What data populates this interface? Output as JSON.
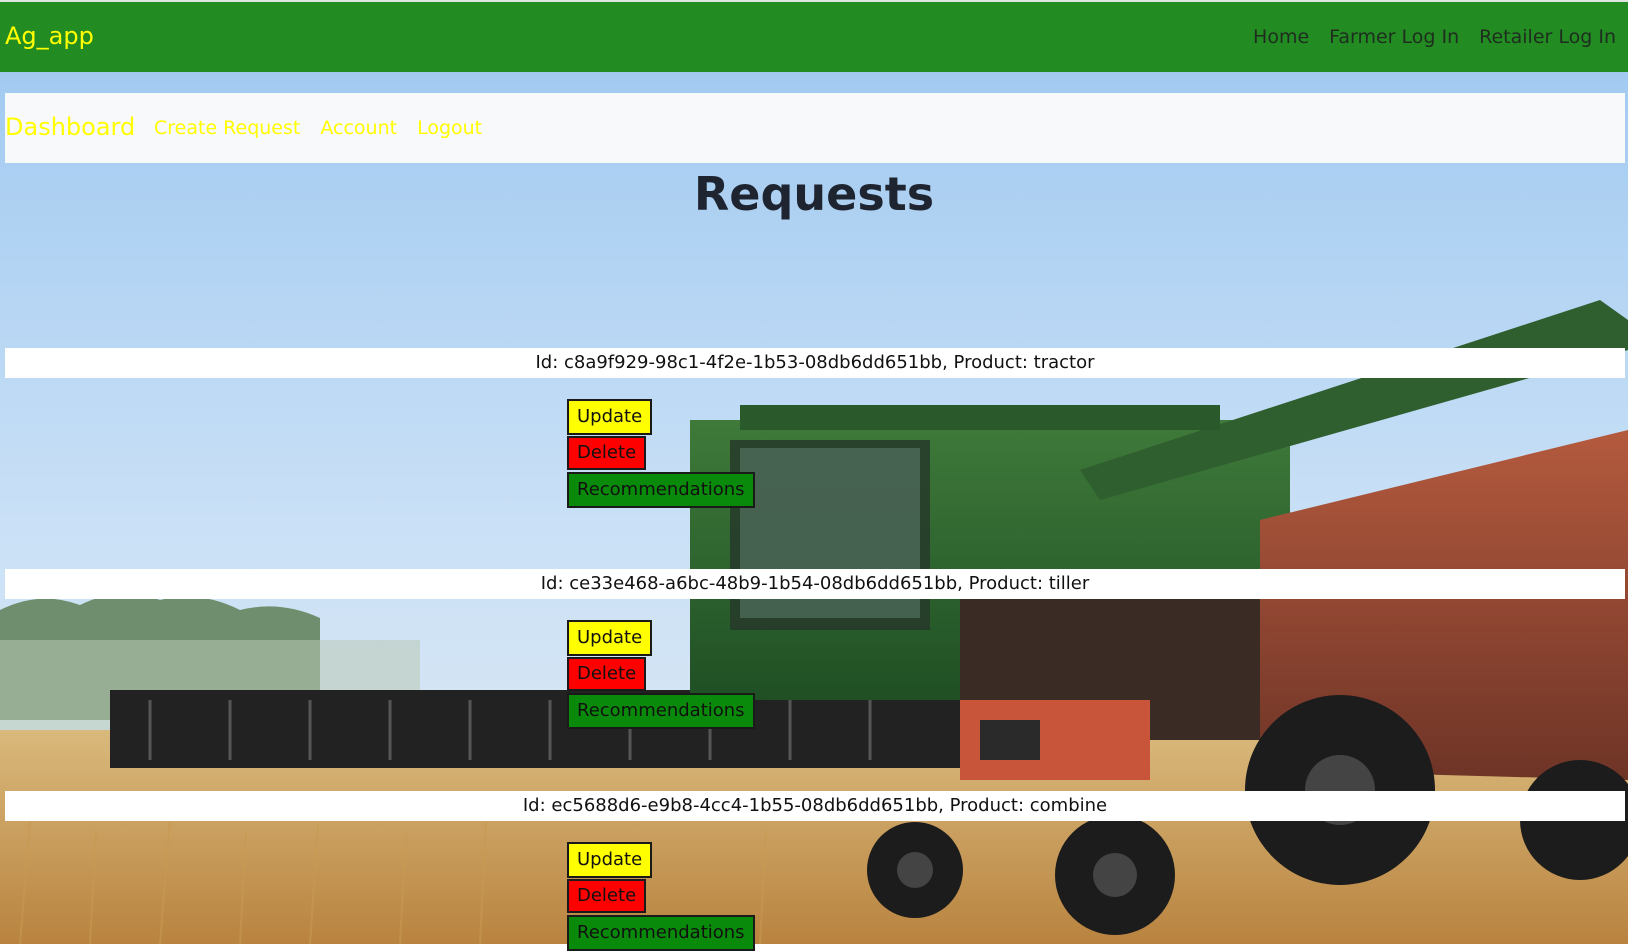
{
  "navbar": {
    "brand": "Ag_app",
    "links": [
      "Home",
      "Farmer Log In",
      "Retailer Log In"
    ],
    "background_color": "#228b22",
    "brand_color": "#ffff00"
  },
  "subnav": {
    "dashboard": "Dashboard",
    "links": [
      "Create Request",
      "Account",
      "Logout"
    ],
    "link_color": "#ffff00"
  },
  "page": {
    "title": "Requests"
  },
  "buttons": {
    "update": "Update",
    "delete": "Delete",
    "recommendations": "Recommendations",
    "colors": {
      "update": "#ffff00",
      "delete": "#ff0000",
      "recommendations": "#0a8a0a"
    }
  },
  "requests": [
    {
      "summary": "Id: c8a9f929-98c1-4f2e-1b53-08db6dd651bb, Product: tractor"
    },
    {
      "summary": "Id: ce33e468-a6bc-48b9-1b54-08db6dd651bb, Product: tiller"
    },
    {
      "summary": "Id: ec5688d6-e9b8-4cc4-1b55-08db6dd651bb, Product: combine"
    }
  ],
  "background": {
    "icon": "farm-field-harvest-photo"
  }
}
